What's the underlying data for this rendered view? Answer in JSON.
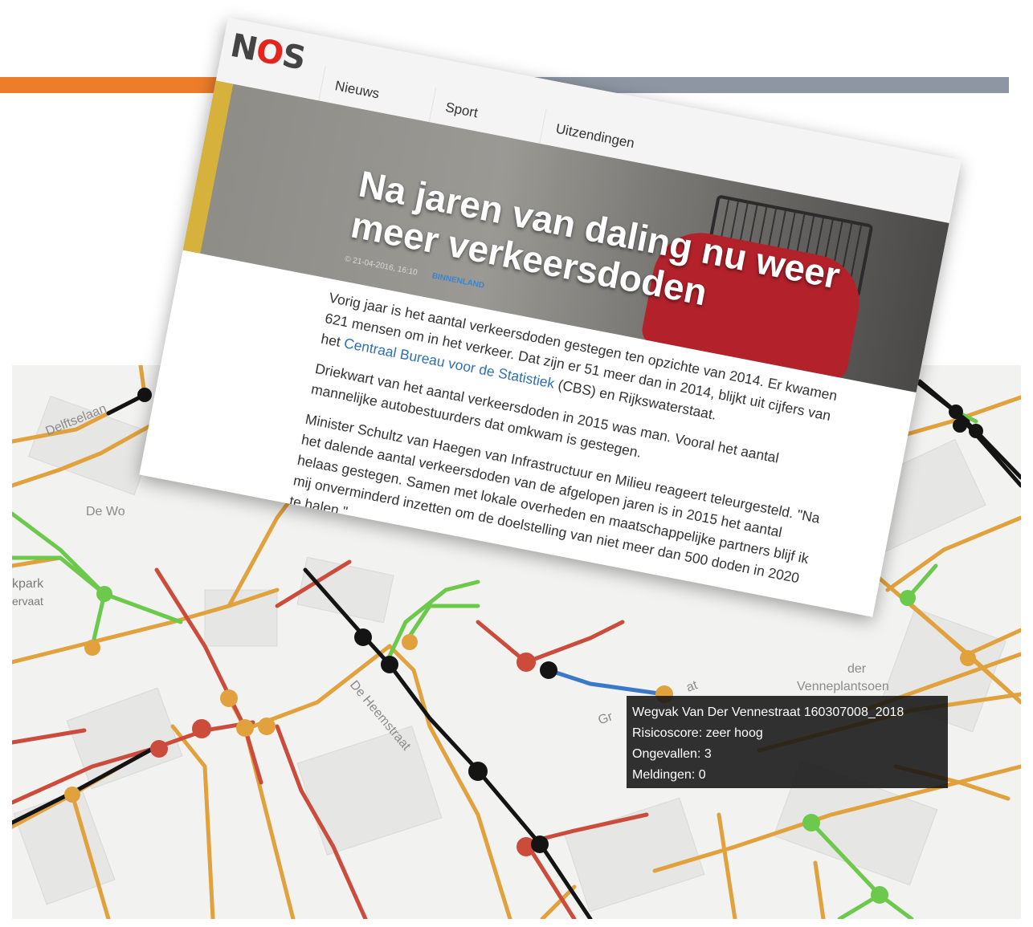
{
  "article": {
    "logo": "NOS",
    "nav": [
      "Nieuws",
      "Sport",
      "Uitzendingen"
    ],
    "title": "Na jaren van daling nu weer meer verkeersdoden",
    "meta_date": "© 21-04-2016, 16:10",
    "meta_category": "BINNENLAND",
    "paragraph1_before": "Vorig jaar is het aantal verkeersdoden gestegen ten opzichte van 2014. Er kwamen 621 mensen om in het verkeer. Dat zijn er 51 meer dan in 2014, blijkt uit cijfers van het ",
    "paragraph1_link": "Centraal Bureau voor de Statistiek",
    "paragraph1_after": " (CBS) en Rijkswaterstaat.",
    "paragraph2": "Driekwart van het aantal verkeersdoden in 2015 was man. Vooral het aantal mannelijke autobestuurders dat omkwam is gestegen.",
    "paragraph3": "Minister Schultz van Haegen van Infrastructuur en Milieu reageert teleurgesteld. \"Na het dalende aantal verkeersdoden van de afgelopen jaren is in 2015 het aantal helaas gestegen. Samen met lokale overheden en maatschappelijke partners blijf ik mij onverminderd inzetten om de doelstelling van niet meer dan 500 doden in 2020 te halen.\""
  },
  "map": {
    "labels": {
      "street1": "Delftselaan",
      "street2": "De Wo",
      "park1": "kpark",
      "park2": "ervaat",
      "street3": "De Heemstraat",
      "street4": "der",
      "street5": "Venneplantsoen",
      "street6": "Gr",
      "street7": "at"
    },
    "tooltip": {
      "line1": "Wegvak Van Der Vennestraat 160307008_2018",
      "line2": "Risicoscore: zeer hoog",
      "line3": "Ongevallen: 3",
      "line4": "Meldingen: 0"
    },
    "colors": {
      "low": "#e1a13d",
      "safe": "#6cc94c",
      "high": "#cc4c3c",
      "extreme": "#141414",
      "selected": "#3a78c9"
    }
  }
}
